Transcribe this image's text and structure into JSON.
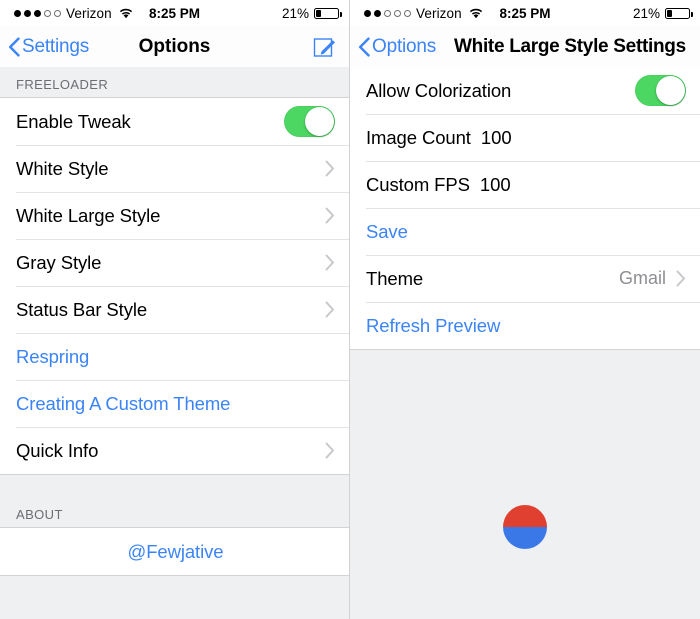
{
  "left": {
    "statusbar": {
      "signal_dots_filled": 3,
      "signal_dots_total": 5,
      "carrier": "Verizon",
      "wifi_icon": "wifi-icon",
      "time": "8:25 PM",
      "battery_percent": "21%",
      "battery_level": 21
    },
    "navbar": {
      "back_label": "Settings",
      "back_icon": "chevron-left-icon",
      "title": "Options",
      "action_icon": "compose-icon"
    },
    "sections": [
      {
        "header": "FREELOADER",
        "rows": [
          {
            "label": "Enable Tweak",
            "type": "switch",
            "switch_on": true,
            "name": "row-enable-tweak"
          },
          {
            "label": "White Style",
            "type": "disclosure",
            "name": "row-white-style"
          },
          {
            "label": "White Large Style",
            "type": "disclosure",
            "name": "row-white-large-style"
          },
          {
            "label": "Gray Style",
            "type": "disclosure",
            "name": "row-gray-style"
          },
          {
            "label": "Status Bar Style",
            "type": "disclosure",
            "name": "row-status-bar-style"
          },
          {
            "label": "Respring",
            "type": "action",
            "name": "row-respring"
          },
          {
            "label": "Creating A Custom Theme",
            "type": "action",
            "name": "row-creating-a-custom-theme"
          },
          {
            "label": "Quick Info",
            "type": "disclosure",
            "name": "row-quick-info"
          }
        ]
      },
      {
        "header": "ABOUT",
        "rows": [
          {
            "label": "@Fewjative",
            "type": "action-center",
            "name": "row-fewjative"
          }
        ]
      }
    ]
  },
  "right": {
    "statusbar": {
      "signal_dots_filled": 2,
      "signal_dots_total": 5,
      "carrier": "Verizon",
      "wifi_icon": "wifi-icon",
      "time": "8:25 PM",
      "battery_percent": "21%",
      "battery_level": 21
    },
    "navbar": {
      "back_label": "Options",
      "back_icon": "chevron-left-icon",
      "title": "White Large Style Settings"
    },
    "rows": [
      {
        "label": "Allow Colorization",
        "type": "switch",
        "switch_on": true,
        "name": "row-allow-colorization"
      },
      {
        "label": "Image Count",
        "value": "100",
        "type": "value",
        "name": "row-image-count"
      },
      {
        "label": "Custom FPS",
        "value": "100",
        "type": "value",
        "name": "row-custom-fps"
      },
      {
        "label": "Save",
        "type": "action",
        "name": "row-save"
      },
      {
        "label": "Theme",
        "detail": "Gmail",
        "type": "detail-disclosure",
        "name": "row-theme"
      },
      {
        "label": "Refresh Preview",
        "type": "action",
        "name": "row-refresh-preview"
      }
    ],
    "preview": {
      "icon_name": "theme-preview-circle",
      "top_color": "#e0402f",
      "bottom_color": "#3b78e7"
    }
  },
  "colors": {
    "accent_blue": "#3b84f7",
    "switch_green": "#4cd662",
    "group_bg": "#ffffff",
    "page_bg": "#eff0f2",
    "header_text": "#6d6d72",
    "detail_text": "#8e8e93"
  }
}
